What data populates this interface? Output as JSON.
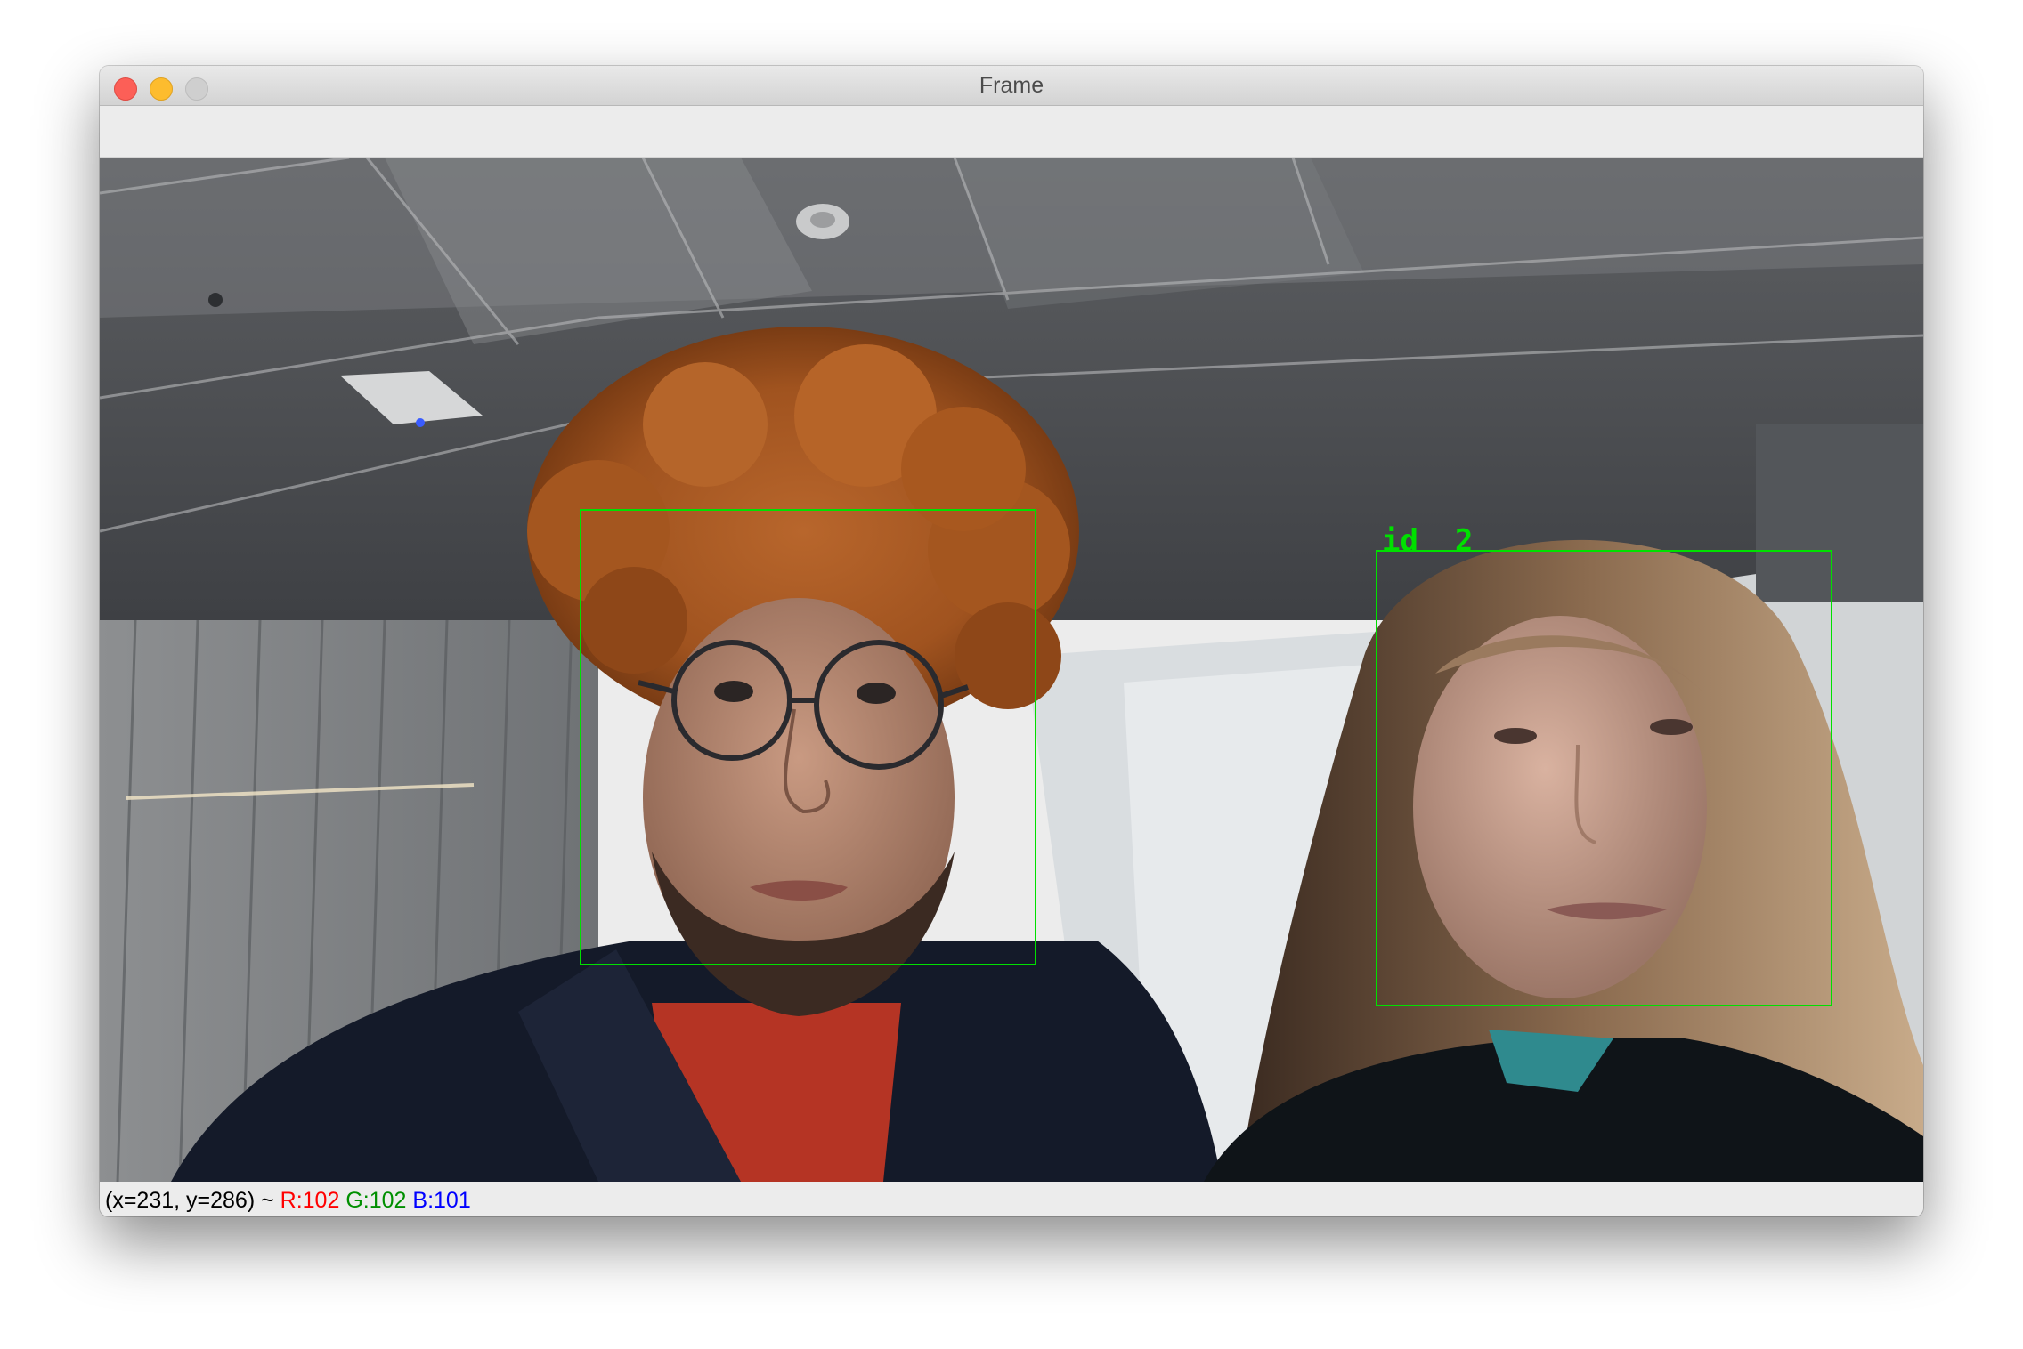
{
  "window": {
    "title": "Frame"
  },
  "detections": [
    {
      "label": "",
      "color": "#00e000"
    },
    {
      "label": "id  2",
      "color": "#00e000"
    }
  ],
  "status": {
    "coords": "(x=231, y=286) ~ ",
    "r": "R:102",
    "g": "G:102",
    "b": "B:101",
    "r_color": "#ff0000",
    "g_color": "#008f00",
    "b_color": "#0000ff"
  }
}
